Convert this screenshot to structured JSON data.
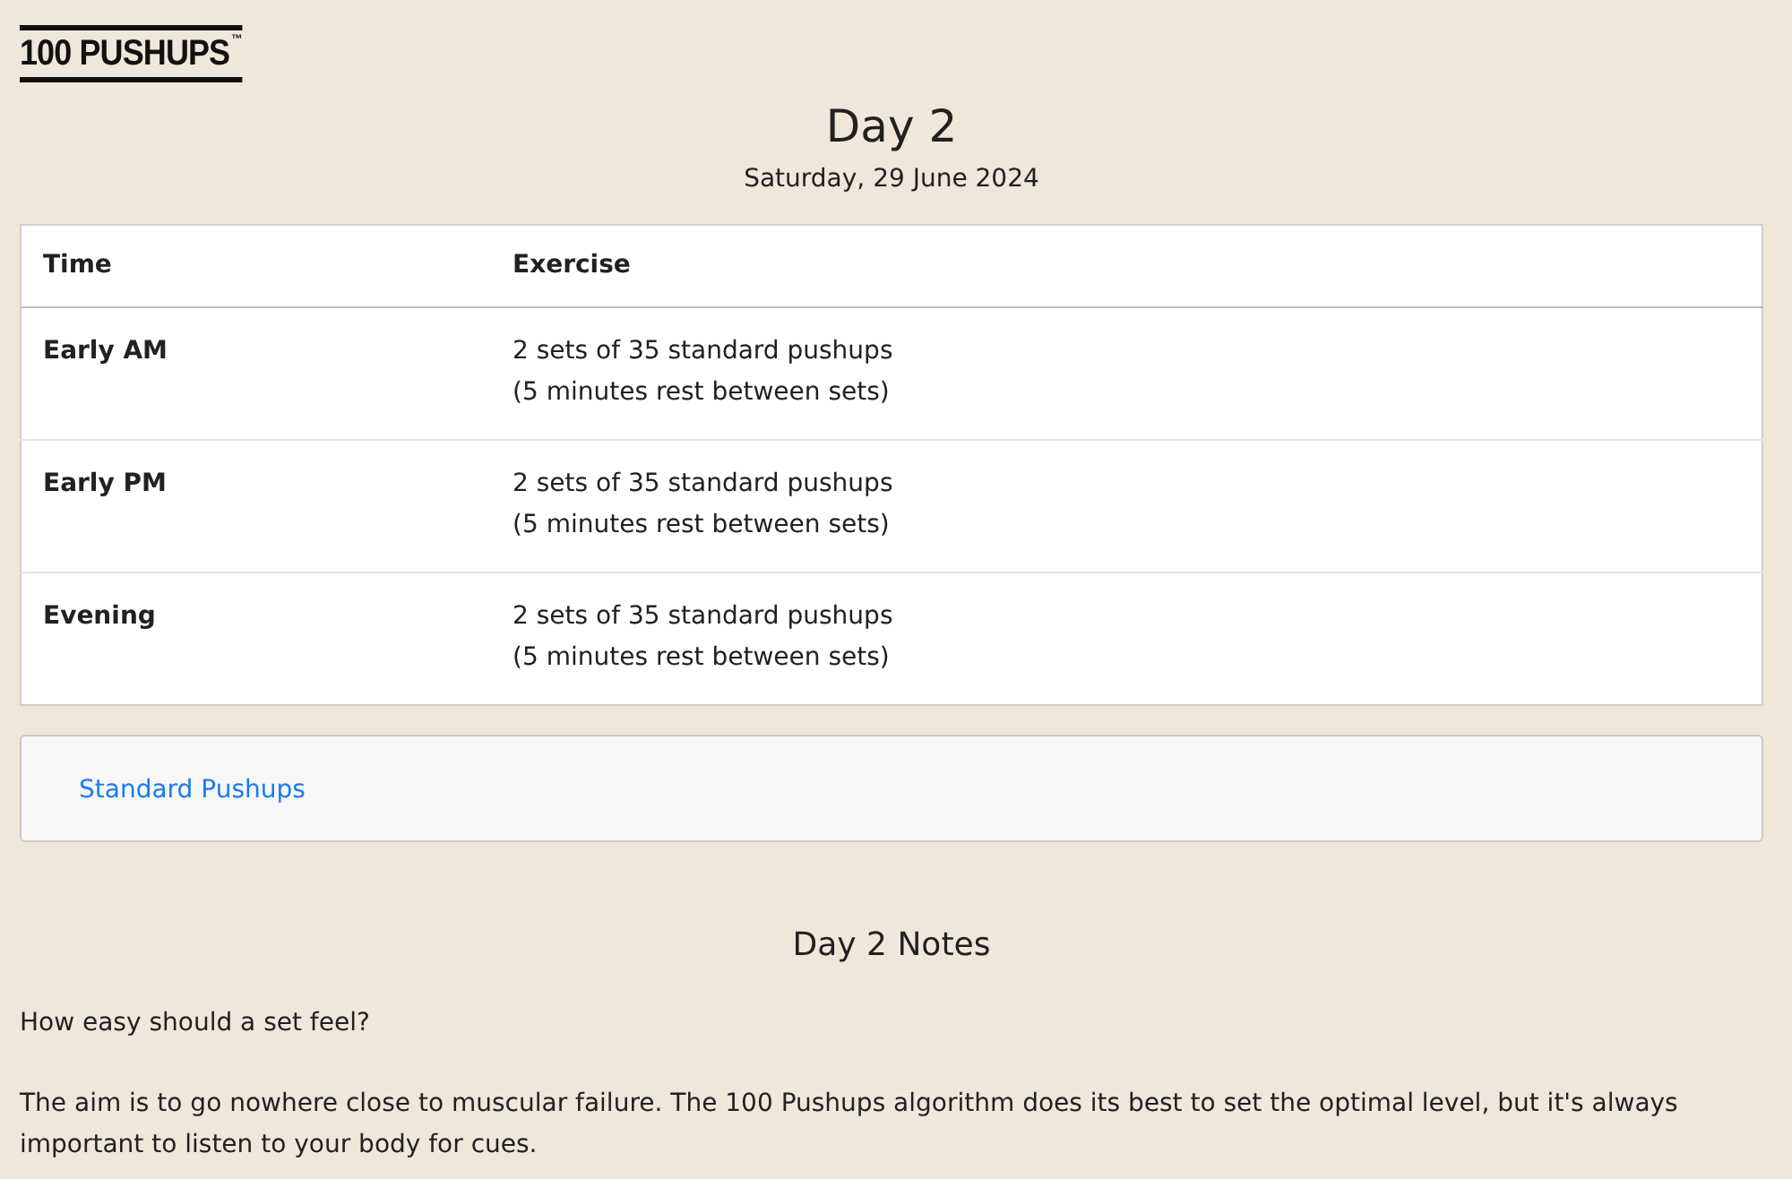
{
  "logo": {
    "text": "100 PUSHUPS",
    "mark": "™"
  },
  "header": {
    "title": "Day 2",
    "date": "Saturday, 29 June 2024"
  },
  "table": {
    "columns": [
      "Time",
      "Exercise"
    ],
    "rows": [
      {
        "time": "Early AM",
        "exercise": [
          "2 sets of 35 standard pushups",
          "(5 minutes rest between sets)"
        ]
      },
      {
        "time": "Early PM",
        "exercise": [
          "2 sets of 35 standard pushups",
          "(5 minutes rest between sets)"
        ]
      },
      {
        "time": "Evening",
        "exercise": [
          "2 sets of 35 standard pushups",
          "(5 minutes rest between sets)"
        ]
      }
    ]
  },
  "links": [
    "Standard Pushups"
  ],
  "notes": {
    "title": "Day 2 Notes",
    "paragraphs": [
      "How easy should a set feel?",
      "The aim is to go nowhere close to muscular failure. The 100 Pushups algorithm does its best to set the optimal level, but it's always important to listen to your body for cues."
    ]
  }
}
